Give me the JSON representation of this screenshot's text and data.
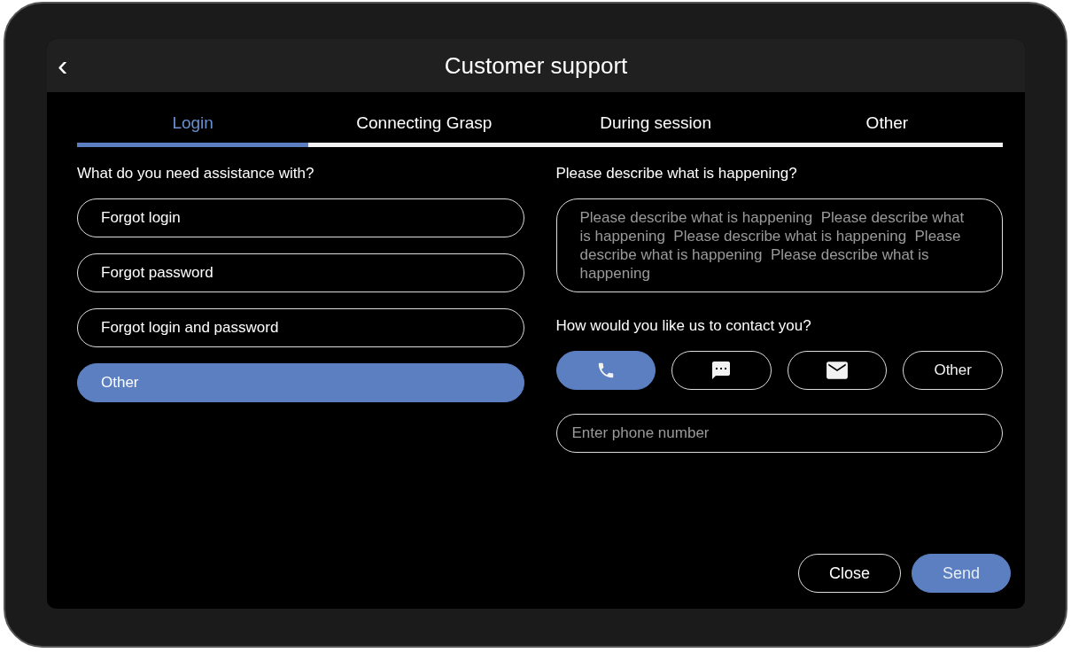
{
  "header": {
    "back": "‹",
    "title": "Customer support"
  },
  "tabs": [
    {
      "label": "Login",
      "selected": true
    },
    {
      "label": "Connecting Grasp",
      "selected": false
    },
    {
      "label": "During session",
      "selected": false
    },
    {
      "label": "Other",
      "selected": false
    }
  ],
  "assistance": {
    "label": "What do you need assistance with?",
    "options": [
      {
        "label": "Forgot login",
        "selected": false
      },
      {
        "label": "Forgot password",
        "selected": false
      },
      {
        "label": "Forgot login and password",
        "selected": false
      },
      {
        "label": "Other",
        "selected": true
      }
    ]
  },
  "description": {
    "label": "Please describe what is happening?",
    "placeholder": "Please describe what is happening  Please describe what is happening  Please describe what is happening  Please describe what is happening  Please describe what is happening"
  },
  "contact": {
    "label": "How would you like us to contact you?",
    "options": [
      {
        "kind": "phone",
        "selected": true
      },
      {
        "kind": "chat",
        "selected": false
      },
      {
        "kind": "mail",
        "selected": false
      },
      {
        "kind": "text",
        "label": "Other",
        "selected": false
      }
    ]
  },
  "phone": {
    "placeholder": "Enter phone number"
  },
  "buttons": [
    {
      "label": "Close",
      "kind": "secondary"
    },
    {
      "label": "Send",
      "kind": "primary"
    }
  ]
}
